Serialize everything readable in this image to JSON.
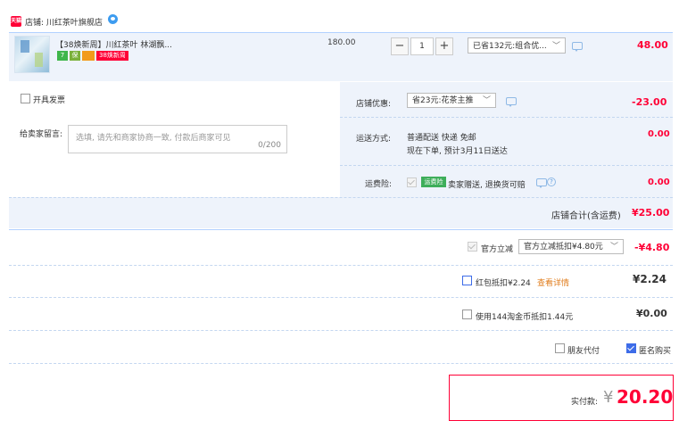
{
  "shop": {
    "badge": "天猫",
    "label": "店铺: 川红茶叶旗舰店"
  },
  "item": {
    "title": "【38焕新周】川红茶叶 林湖飘...",
    "badge_7": "7",
    "badge_guarantee": "保",
    "badge_card": "",
    "badge_promo": "38焕新周",
    "unit_price": "180.00",
    "qty_minus": "−",
    "qty_value": "1",
    "qty_plus": "+",
    "promo_select": "已省132元:组合优...",
    "subtotal": "48.00"
  },
  "options": {
    "invoice_label": "开具发票",
    "message_label": "给卖家留言:",
    "message_placeholder": "选填, 请先和商家协商一致, 付款后商家可见",
    "message_count": "0/200",
    "shop_discount_label": "店铺优惠:",
    "shop_discount_select": "省23元:花茶主推",
    "shop_discount_value": "-23.00",
    "shipping_label": "运送方式:",
    "shipping_line1": "普通配送 快递 免邮",
    "shipping_line2": "现在下单, 预计3月11日送达",
    "shipping_value": "0.00",
    "insurance_label": "运费险:",
    "insurance_tag": "运费险",
    "insurance_text": "卖家赠送, 退换货可赔",
    "insurance_value": "0.00",
    "shop_total_label": "店铺合计(含运费)",
    "shop_total_value": "¥25.00"
  },
  "summary": {
    "direct_discount_label": "官方立减",
    "direct_discount_select": "官方立减抵扣¥4.80元",
    "direct_discount_value": "-¥4.80",
    "redpacket_label": "红包抵扣¥2.24",
    "redpacket_link": "查看详情",
    "redpacket_value": "¥2.24",
    "coins_label": "使用144淘金币抵扣1.44元",
    "coins_value": "¥0.00",
    "friend_pay_label": "朋友代付",
    "anonymous_label": "匿名购买",
    "pay_label": "实付款:",
    "pay_currency": "¥",
    "pay_amount": "20.20"
  },
  "colors": {
    "accent_red": "#ff0036",
    "panel_blue": "#eef3fb",
    "check_blue": "#3d6ce8"
  }
}
